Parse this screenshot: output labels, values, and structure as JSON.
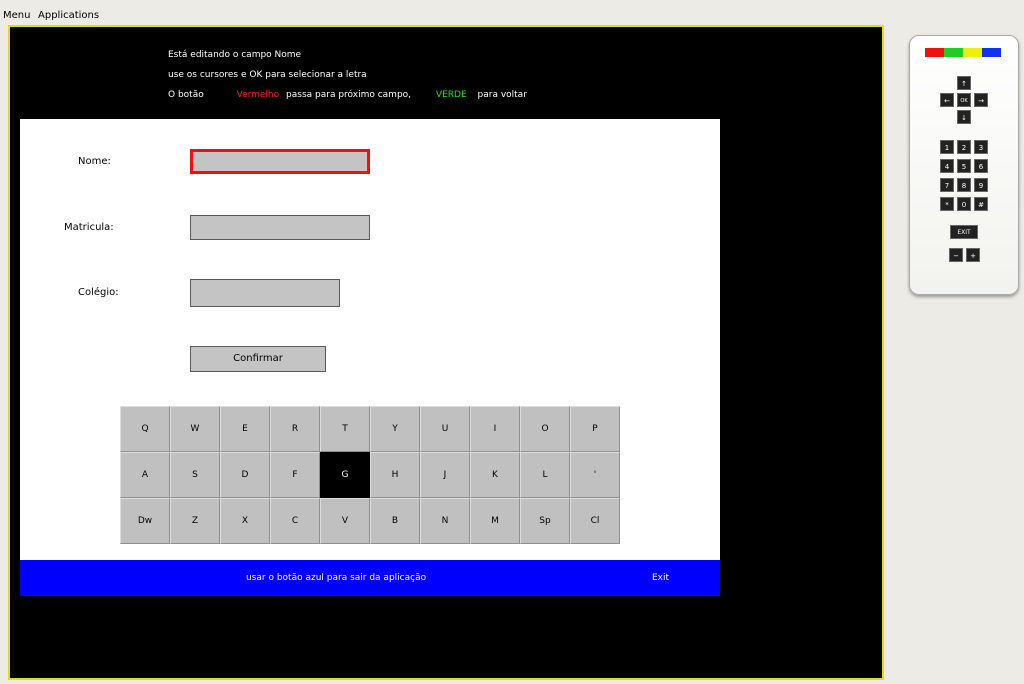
{
  "menubar": {
    "menu": "Menu",
    "applications": "Applications"
  },
  "instructions": {
    "line1": "Está editando o campo Nome",
    "line2": "use os cursores e OK para selecionar a letra",
    "line3_prefix": "O botão",
    "red_word": "Vermelho",
    "line3_middle": "passa para próximo campo,",
    "green_word": "VERDE",
    "line3_suffix": "para voltar"
  },
  "form": {
    "nome_label": "Nome:",
    "matricula_label": "Matricula:",
    "colegio_label": "Colégio:",
    "nome_value": "",
    "matricula_value": "",
    "colegio_value": "",
    "confirm_label": "Confirmar"
  },
  "keyboard": {
    "rows": [
      [
        "Q",
        "W",
        "E",
        "R",
        "T",
        "Y",
        "U",
        "I",
        "O",
        "P"
      ],
      [
        "A",
        "S",
        "D",
        "F",
        "G",
        "H",
        "J",
        "K",
        "L",
        "'"
      ],
      [
        "Dw",
        "Z",
        "X",
        "C",
        "V",
        "B",
        "N",
        "M",
        "Sp",
        "Cl"
      ]
    ],
    "selected": "G"
  },
  "footer": {
    "hint": "usar o botão azul para sair da aplicação",
    "exit": "Exit"
  },
  "remote": {
    "colors": [
      "#ee1111",
      "#22cc22",
      "#eeee11",
      "#1133ee"
    ],
    "arrows": {
      "up": "↑",
      "left": "←",
      "ok": "OK",
      "right": "→",
      "down": "↓"
    },
    "keypad": [
      "1",
      "2",
      "3",
      "4",
      "5",
      "6",
      "7",
      "8",
      "9",
      "*",
      "0",
      "#"
    ],
    "exit": "EXIT",
    "minus": "−",
    "plus": "+"
  },
  "accents": {
    "tv_border": "#e6d91a",
    "footer_bg": "#0000ff",
    "active_field_border": "#ee1111"
  }
}
